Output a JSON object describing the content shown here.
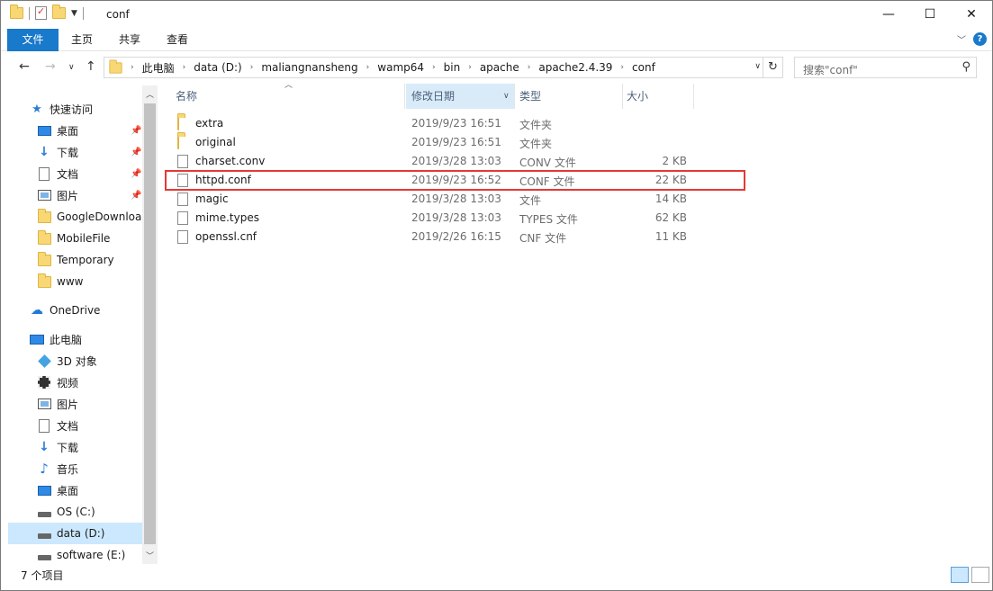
{
  "window": {
    "title": "conf"
  },
  "ribbon": {
    "tabs": [
      "文件",
      "主页",
      "共享",
      "查看"
    ]
  },
  "address": {
    "crumbs": [
      "此电脑",
      "data (D:)",
      "maliangnansheng",
      "wamp64",
      "bin",
      "apache",
      "apache2.4.39",
      "conf"
    ]
  },
  "search": {
    "placeholder": "搜索\"conf\""
  },
  "nav": {
    "quick_access": "快速访问",
    "items": [
      {
        "label": "桌面",
        "icon": "desktop-icon"
      },
      {
        "label": "下载",
        "icon": "download-icon"
      },
      {
        "label": "文档",
        "icon": "document-icon"
      },
      {
        "label": "图片",
        "icon": "pictures-icon"
      },
      {
        "label": "GoogleDownload",
        "icon": "folder-icon"
      },
      {
        "label": "MobileFile",
        "icon": "folder-icon"
      },
      {
        "label": "Temporary",
        "icon": "folder-icon"
      },
      {
        "label": "www",
        "icon": "folder-icon"
      }
    ],
    "onedrive": "OneDrive",
    "this_pc": "此电脑",
    "pc_items": [
      {
        "label": "3D 对象",
        "icon": "3d-objects-icon"
      },
      {
        "label": "视频",
        "icon": "video-icon"
      },
      {
        "label": "图片",
        "icon": "pictures-icon"
      },
      {
        "label": "文档",
        "icon": "document-icon"
      },
      {
        "label": "下载",
        "icon": "download-icon"
      },
      {
        "label": "音乐",
        "icon": "music-icon"
      },
      {
        "label": "桌面",
        "icon": "desktop-icon"
      },
      {
        "label": "OS (C:)",
        "icon": "drive-icon"
      },
      {
        "label": "data (D:)",
        "icon": "drive-icon"
      },
      {
        "label": "software (E:)",
        "icon": "drive-icon"
      }
    ]
  },
  "columns": {
    "name": "名称",
    "date": "修改日期",
    "type": "类型",
    "size": "大小"
  },
  "files": [
    {
      "name": "extra",
      "date": "2019/9/23 16:51",
      "type": "文件夹",
      "size": "",
      "kind": "folder"
    },
    {
      "name": "original",
      "date": "2019/9/23 16:51",
      "type": "文件夹",
      "size": "",
      "kind": "folder"
    },
    {
      "name": "charset.conv",
      "date": "2019/3/28 13:03",
      "type": "CONV 文件",
      "size": "2 KB",
      "kind": "file"
    },
    {
      "name": "httpd.conf",
      "date": "2019/9/23 16:52",
      "type": "CONF 文件",
      "size": "22 KB",
      "kind": "file"
    },
    {
      "name": "magic",
      "date": "2019/3/28 13:03",
      "type": "文件",
      "size": "14 KB",
      "kind": "file"
    },
    {
      "name": "mime.types",
      "date": "2019/3/28 13:03",
      "type": "TYPES 文件",
      "size": "62 KB",
      "kind": "file"
    },
    {
      "name": "openssl.cnf",
      "date": "2019/2/26 16:15",
      "type": "CNF 文件",
      "size": "11 KB",
      "kind": "file"
    }
  ],
  "status": {
    "count": "7 个项目"
  },
  "colors": {
    "accent": "#1979ca",
    "highlight_box": "#e53935",
    "selection": "#cce8ff"
  }
}
